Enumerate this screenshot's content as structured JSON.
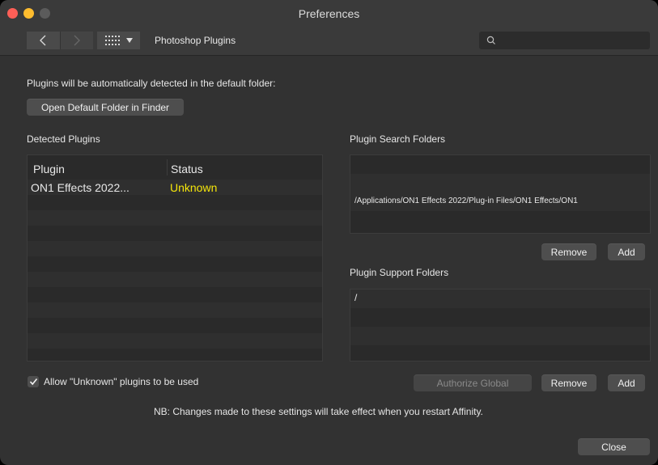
{
  "window": {
    "title": "Preferences"
  },
  "toolbar": {
    "back_glyph": "<",
    "forward_glyph": ">",
    "section_title": "Photoshop Plugins",
    "search_placeholder": ""
  },
  "intro": {
    "text": "Plugins will be automatically detected in the default folder:",
    "open_folder_label": "Open Default Folder in Finder"
  },
  "detected": {
    "title": "Detected Plugins",
    "columns": [
      "Plugin",
      "Status"
    ],
    "rows": [
      {
        "plugin": "ON1 Effects 2022...",
        "status": "Unknown"
      }
    ]
  },
  "search_folders": {
    "title": "Plugin Search Folders",
    "paths": [
      "/Applications/ON1 Effects 2022/Plug-in Files/ON1 Effects/ON1"
    ],
    "remove_label": "Remove",
    "add_label": "Add"
  },
  "support_folders": {
    "title": "Plugin Support Folders",
    "paths": [
      "/"
    ],
    "authorize_label": "Authorize Global",
    "remove_label": "Remove",
    "add_label": "Add"
  },
  "allow_unknown": {
    "label": "Allow \"Unknown\" plugins to be used",
    "checked": true
  },
  "note": "NB: Changes made to these settings will take effect when you restart Affinity.",
  "close_label": "Close",
  "colors": {
    "status_unknown": "#f5e60a",
    "close_red": "#fe5f57",
    "minimize_yellow": "#febc2e"
  }
}
